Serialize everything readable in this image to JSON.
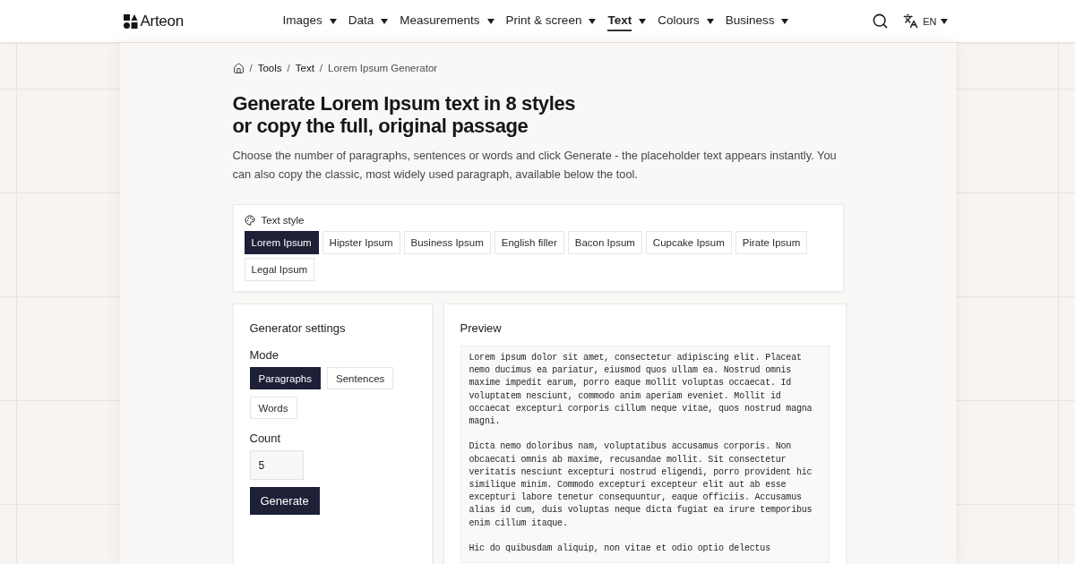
{
  "header": {
    "logo": "Arteon",
    "nav": [
      {
        "label": "Images",
        "selected": false
      },
      {
        "label": "Data",
        "selected": false
      },
      {
        "label": "Measurements",
        "selected": false
      },
      {
        "label": "Print & screen",
        "selected": false
      },
      {
        "label": "Text",
        "selected": true
      },
      {
        "label": "Colours",
        "selected": false
      },
      {
        "label": "Business",
        "selected": false
      }
    ],
    "language": "EN"
  },
  "breadcrumb": [
    {
      "separator": "/",
      "label": "Tools",
      "current": false
    },
    {
      "separator": "/",
      "label": "Text",
      "current": false
    },
    {
      "separator": "/",
      "label": "Lorem Ipsum Generator",
      "current": true
    }
  ],
  "intro": {
    "title": "Generate Lorem Ipsum text in 8 styles or copy the full, original passage",
    "description": "Choose the number of paragraphs, sentences or words and click Generate - the placeholder text appears instantly. You can also copy the classic, most widely used paragraph, available below the tool."
  },
  "text_style": {
    "label": "Text style",
    "options": [
      {
        "label": "Lorem Ipsum",
        "selected": true
      },
      {
        "label": "Hipster Ipsum",
        "selected": false
      },
      {
        "label": "Business Ipsum",
        "selected": false
      },
      {
        "label": "English filler",
        "selected": false
      },
      {
        "label": "Bacon Ipsum",
        "selected": false
      },
      {
        "label": "Cupcake Ipsum",
        "selected": false
      },
      {
        "label": "Pirate Ipsum",
        "selected": false
      },
      {
        "label": "Legal Ipsum",
        "selected": false
      }
    ]
  },
  "generator": {
    "title": "Generator settings",
    "mode_label": "Mode",
    "modes": [
      {
        "label": "Paragraphs",
        "selected": true
      },
      {
        "label": "Sentences",
        "selected": false
      },
      {
        "label": "Words",
        "selected": false
      }
    ],
    "count_label": "Count",
    "count": "5",
    "button": "Generate"
  },
  "preview": {
    "title": "Preview",
    "paragraphs": [
      "Lorem ipsum dolor sit amet, consectetur adipiscing elit. Placeat nemo ducimus ea pariatur, eiusmod quos ullam ea. Nostrud omnis maxime impedit earum, porro eaque mollit voluptas occaecat. Id voluptatem nesciunt, commodo anim aperiam eveniet. Mollit id occaecat excepturi corporis cillum neque vitae, quos nostrud magna magni.",
      "Dicta nemo doloribus nam, voluptatibus accusamus corporis. Non obcaecati omnis ab maxime, recusandae mollit. Sit consectetur veritatis nesciunt excepturi nostrud eligendi, porro provident hic similique minim. Commodo excepturi excepteur elit aut ab esse excepturi labore tenetur consequuntur, eaque officiis. Accusamus alias id cum, duis voluptas neque dicta fugiat ea irure temporibus enim cillum itaque.",
      "Hic do quibusdam aliquip, non vitae et odio optio delectus"
    ]
  }
}
